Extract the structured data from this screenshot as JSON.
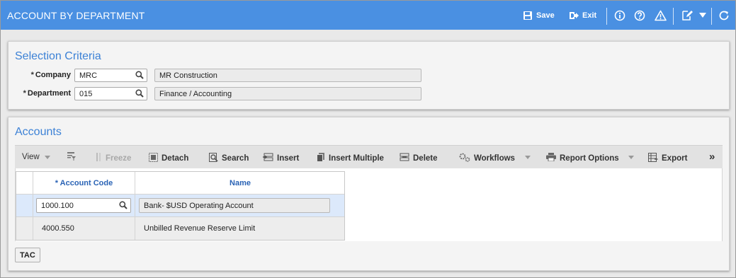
{
  "header": {
    "title": "ACCOUNT BY DEPARTMENT",
    "save_label": "Save",
    "exit_label": "Exit",
    "bg_color": "#4a90e2"
  },
  "selection": {
    "title": "Selection Criteria",
    "company": {
      "required_mark": "*",
      "label": "Company",
      "value": "MRC",
      "description": "MR Construction"
    },
    "department": {
      "required_mark": "*",
      "label": "Department",
      "value": "015",
      "description": "Finance / Accounting"
    }
  },
  "accounts": {
    "title": "Accounts",
    "toolbar": {
      "view": "View",
      "freeze": "Freeze",
      "detach": "Detach",
      "search": "Search",
      "insert": "Insert",
      "insert_multiple": "Insert Multiple",
      "delete": "Delete",
      "workflows": "Workflows",
      "report_options": "Report Options",
      "export": "Export",
      "more": "»"
    },
    "columns": {
      "account_code": "* Account Code",
      "name": "Name"
    },
    "rows": [
      {
        "account_code": "1000.100",
        "name": "Bank- $USD Operating Account",
        "editing": true
      },
      {
        "account_code": "4000.550",
        "name": "Unbilled Revenue Reserve Limit",
        "editing": false
      }
    ],
    "tac_button": "TAC"
  },
  "icons": [
    "save-icon",
    "exit-icon",
    "info-icon",
    "help-icon",
    "warning-icon",
    "edit-icon",
    "chevron-down-icon",
    "refresh-icon",
    "search-icon",
    "filter-icon",
    "freeze-icon",
    "detach-icon",
    "insert-icon",
    "insert-multiple-icon",
    "delete-icon",
    "workflows-icon",
    "print-icon",
    "export-icon"
  ]
}
